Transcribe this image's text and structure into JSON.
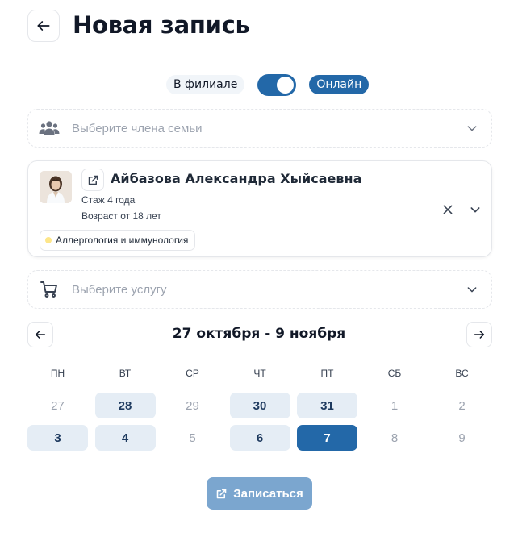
{
  "header": {
    "title": "Новая запись"
  },
  "mode": {
    "branch_label": "В филиале",
    "online_label": "Онлайн",
    "online_enabled": true
  },
  "family_select": {
    "placeholder": "Выберите члена семьи",
    "icon": "family-users-icon"
  },
  "doctor": {
    "name": "Айбазова Александра Хыйсаевна",
    "experience": "Стаж 4 года",
    "age": "Возраст от 18 лет",
    "specialty": "Аллергология и иммунология"
  },
  "service_select": {
    "placeholder": "Выберите услугу",
    "icon": "cart-icon"
  },
  "calendar": {
    "range": "27 октября - 9 ноября",
    "weekdays": [
      "ПН",
      "ВТ",
      "СР",
      "ЧТ",
      "ПТ",
      "СБ",
      "ВС"
    ],
    "weeks": [
      [
        {
          "day": "27",
          "state": "unavailable"
        },
        {
          "day": "28",
          "state": "available"
        },
        {
          "day": "29",
          "state": "unavailable"
        },
        {
          "day": "30",
          "state": "available"
        },
        {
          "day": "31",
          "state": "available"
        },
        {
          "day": "1",
          "state": "unavailable"
        },
        {
          "day": "2",
          "state": "unavailable"
        }
      ],
      [
        {
          "day": "3",
          "state": "available"
        },
        {
          "day": "4",
          "state": "available"
        },
        {
          "day": "5",
          "state": "unavailable"
        },
        {
          "day": "6",
          "state": "available"
        },
        {
          "day": "7",
          "state": "selected"
        },
        {
          "day": "8",
          "state": "unavailable"
        },
        {
          "day": "9",
          "state": "unavailable"
        }
      ]
    ]
  },
  "submit": {
    "label": "Записаться"
  },
  "colors": {
    "accent": "#2368a8",
    "available_bg": "#e5edf5",
    "submit_disabled": "#7ba6cf"
  }
}
